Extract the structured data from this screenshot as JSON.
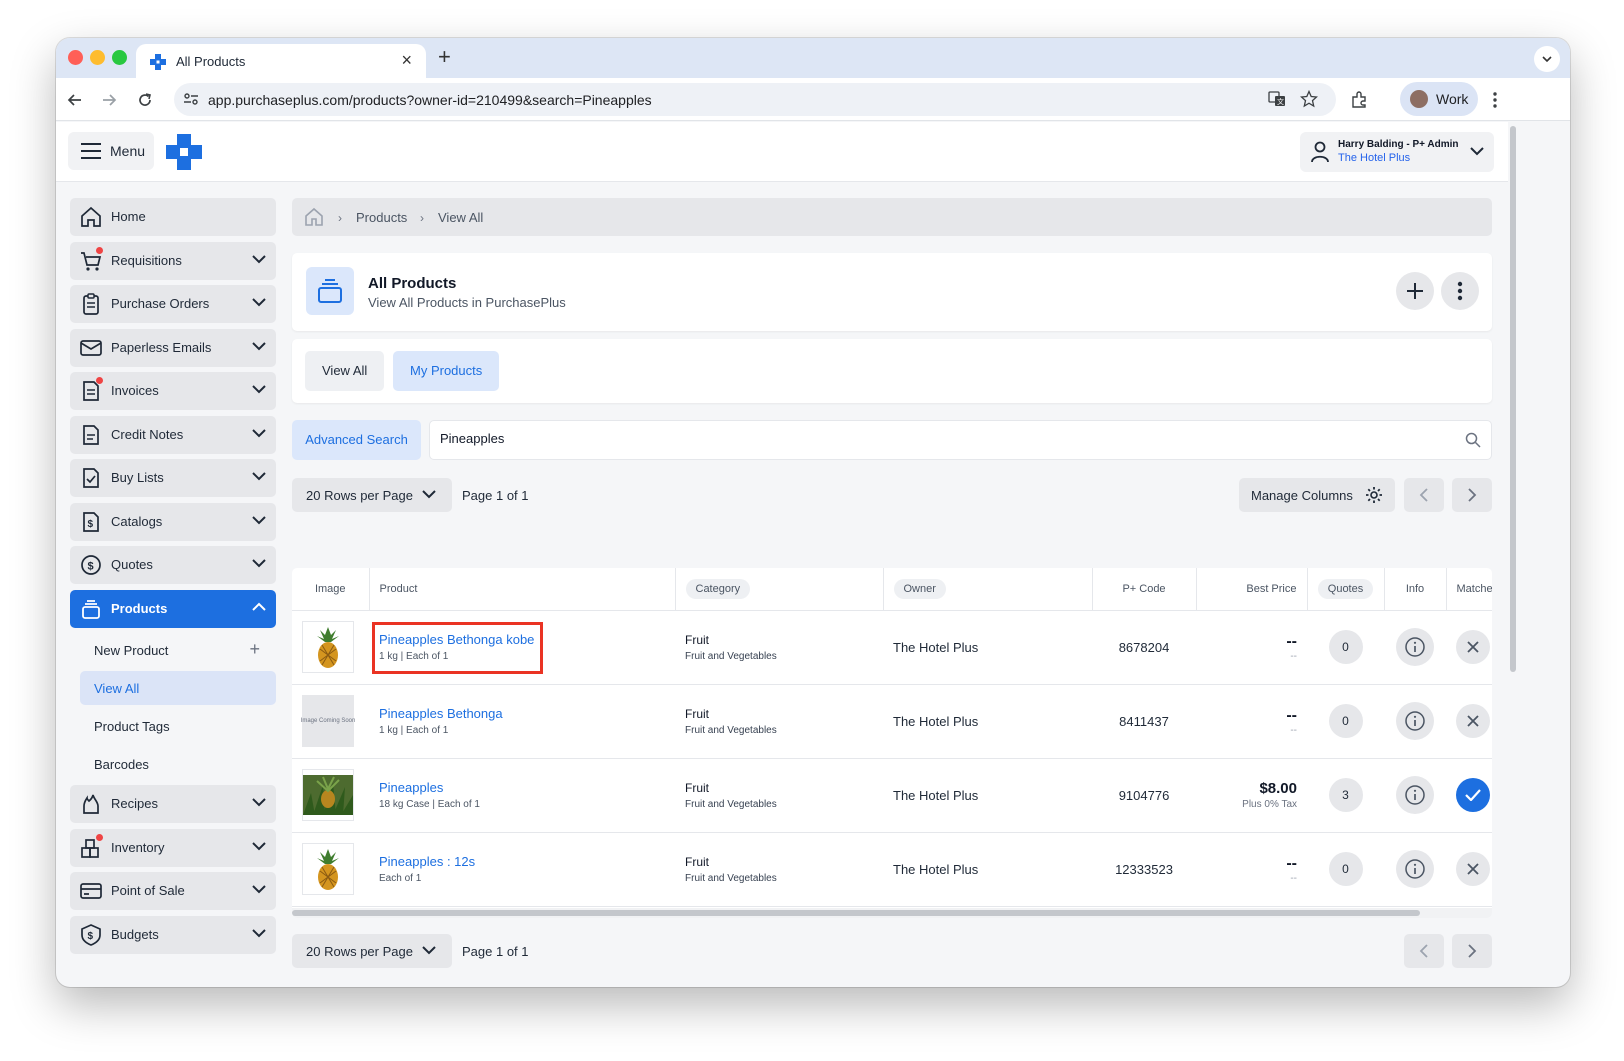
{
  "browser": {
    "tab_title": "All Products",
    "url_domain": "app.purchaseplus.com",
    "url_path": "/products?owner-id=210499&search=Pineapples",
    "profile_label": "Work"
  },
  "header": {
    "menu_label": "Menu",
    "user_name": "Harry Balding - P+ Admin",
    "user_org": "The Hotel Plus"
  },
  "sidebar": {
    "items": [
      {
        "label": "Home",
        "icon": "home-icon"
      },
      {
        "label": "Requisitions",
        "icon": "cart-icon",
        "badge": true
      },
      {
        "label": "Purchase Orders",
        "icon": "clipboard-icon"
      },
      {
        "label": "Paperless Emails",
        "icon": "mail-icon"
      },
      {
        "label": "Invoices",
        "icon": "invoice-icon",
        "badge": true
      },
      {
        "label": "Credit Notes",
        "icon": "document-icon"
      },
      {
        "label": "Buy Lists",
        "icon": "checklist-icon"
      },
      {
        "label": "Catalogs",
        "icon": "dollar-document-icon"
      },
      {
        "label": "Quotes",
        "icon": "dollar-circle-icon"
      },
      {
        "label": "Products",
        "icon": "products-icon",
        "active": true
      },
      {
        "label": "Recipes",
        "icon": "fire-icon"
      },
      {
        "label": "Inventory",
        "icon": "inventory-icon",
        "badge": true
      },
      {
        "label": "Point of Sale",
        "icon": "card-icon"
      },
      {
        "label": "Budgets",
        "icon": "shield-dollar-icon"
      }
    ],
    "products_sub": [
      {
        "label": "New Product"
      },
      {
        "label": "View All",
        "active": true
      },
      {
        "label": "Product Tags"
      },
      {
        "label": "Barcodes"
      }
    ]
  },
  "breadcrumb": {
    "items": [
      "Products",
      "View All"
    ]
  },
  "page": {
    "title": "All Products",
    "subtitle": "View All Products in PurchasePlus"
  },
  "tabs": {
    "view_all": "View All",
    "my_products": "My Products"
  },
  "search": {
    "advanced_label": "Advanced Search",
    "value": "Pineapples"
  },
  "pager": {
    "rows_label": "20 Rows per Page",
    "page_info": "Page 1 of 1",
    "manage_columns": "Manage Columns"
  },
  "table": {
    "columns": [
      "Image",
      "Product",
      "Category",
      "Owner",
      "P+ Code",
      "Best Price",
      "Quotes",
      "Info",
      "Matched"
    ],
    "rows": [
      {
        "name": "Pineapples Bethonga kobe",
        "desc": "1 kg | Each of 1",
        "category": "Fruit",
        "subcategory": "Fruit and Vegetables",
        "owner": "The Hotel Plus",
        "code": "8678204",
        "price": "--",
        "price_sub": "--",
        "quotes": "0",
        "matched": false,
        "image": "pineapple"
      },
      {
        "name": "Pineapples Bethonga",
        "desc": "1 kg | Each of 1",
        "category": "Fruit",
        "subcategory": "Fruit and Vegetables",
        "owner": "The Hotel Plus",
        "code": "8411437",
        "price": "--",
        "price_sub": "--",
        "quotes": "0",
        "matched": false,
        "image": "coming-soon",
        "image_text": "Image Coming Soon"
      },
      {
        "name": "Pineapples",
        "desc": "18 kg Case | Each of 1",
        "category": "Fruit",
        "subcategory": "Fruit and Vegetables",
        "owner": "The Hotel Plus",
        "code": "9104776",
        "price": "$8.00",
        "price_sub": "Plus 0% Tax",
        "quotes": "3",
        "matched": true,
        "image": "pineapple-field"
      },
      {
        "name": "Pineapples : 12s",
        "desc": "Each of 1",
        "category": "Fruit",
        "subcategory": "Fruit and Vegetables",
        "owner": "The Hotel Plus",
        "code": "12333523",
        "price": "--",
        "price_sub": "--",
        "quotes": "0",
        "matched": false,
        "image": "pineapple"
      }
    ]
  },
  "colors": {
    "accent": "#1d6fe0",
    "highlight": "#ea3323",
    "badge": "#ef4444"
  }
}
